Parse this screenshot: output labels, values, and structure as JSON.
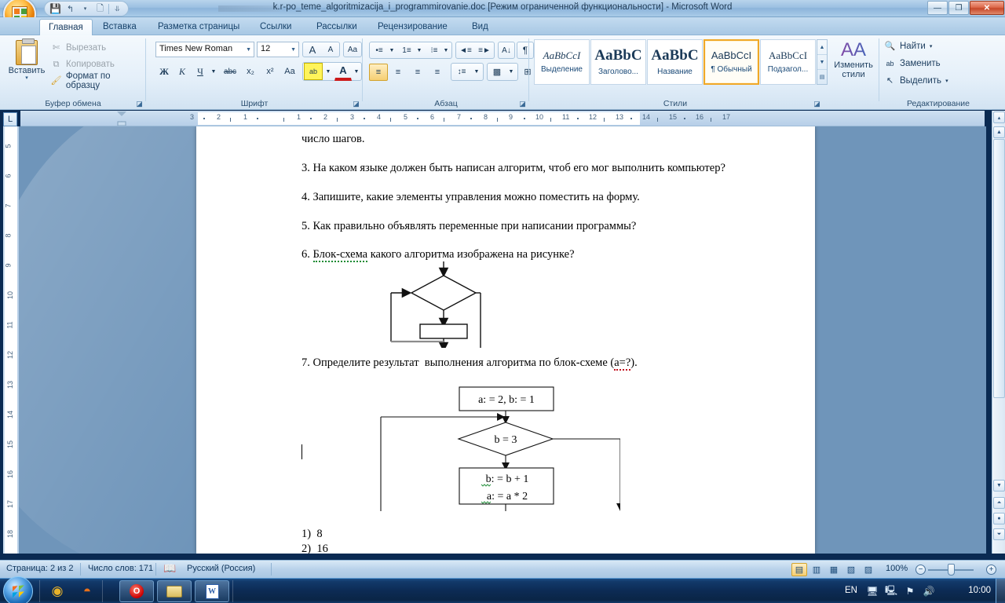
{
  "window": {
    "title": "k.r-po_teme_algoritmizacija_i_programmirovanie.doc [Режим ограниченной функциональности] - Microsoft Word",
    "minimize_label": "—",
    "restore_label": "❐",
    "close_label": "✕"
  },
  "quick_access": {
    "save_label": "💾",
    "undo_label": "↰",
    "undo_arrow": "▾",
    "new_label": "🗋",
    "customize_label": "⥥"
  },
  "ribbon": {
    "tabs": [
      {
        "label": "Главная",
        "active": true
      },
      {
        "label": "Вставка",
        "active": false
      },
      {
        "label": "Разметка страницы",
        "active": false
      },
      {
        "label": "Ссылки",
        "active": false
      },
      {
        "label": "Рассылки",
        "active": false
      },
      {
        "label": "Рецензирование",
        "active": false
      },
      {
        "label": "Вид",
        "active": false
      }
    ],
    "clipboard": {
      "group_label": "Буфер обмена",
      "paste_label": "Вставить",
      "paste_arrow": "▾",
      "cut_label": "Вырезать",
      "copy_label": "Копировать",
      "format_painter_label": "Формат по образцу",
      "launcher": "◪"
    },
    "font": {
      "group_label": "Шрифт",
      "font_name": "Times New Roman",
      "font_size": "12",
      "grow_label": "A",
      "shrink_label": "A",
      "clear_format_label": "Aa",
      "bold_label": "Ж",
      "italic_label": "К",
      "underline_label": "Ч",
      "strike_label": "abc",
      "subscript_label": "x₂",
      "superscript_label": "x²",
      "change_case_label": "Aa",
      "highlight_label": "ab",
      "font_color_label": "A",
      "launcher": "◪"
    },
    "paragraph": {
      "group_label": "Абзац",
      "bullets_label": "•≡",
      "numbering_label": "1≡",
      "multilevel_label": "⁝≡",
      "decrease_indent_label": "◄≡",
      "increase_indent_label": "≡►",
      "sort_label": "A↓",
      "marks_label": "¶",
      "align_left_label": "≡",
      "align_center_label": "≡",
      "align_right_label": "≡",
      "justify_label": "≡",
      "line_spacing_label": "↕≡",
      "shading_label": "▩",
      "borders_label": "⊞",
      "launcher": "◪"
    },
    "styles": {
      "group_label": "Стили",
      "items": [
        {
          "sample": "AaBbCcI",
          "name": "Выделение",
          "selected": false,
          "style": "italic-serif"
        },
        {
          "sample": "AaBbC",
          "name": "Заголово...",
          "selected": false,
          "style": "bold-serif-lg"
        },
        {
          "sample": "AaBbC",
          "name": "Название",
          "selected": false,
          "style": "bold-serif-lg"
        },
        {
          "sample": "AaBbCcI",
          "name": "¶ Обычный",
          "selected": true,
          "style": "plain-sans"
        },
        {
          "sample": "AaBbCcI",
          "name": "Подзагол...",
          "selected": false,
          "style": "plain-serif"
        }
      ],
      "scroll_up": "▲",
      "scroll_down": "▼",
      "scroll_more": "▤",
      "change_styles_label": "Изменить",
      "change_styles_label2": "стили",
      "change_styles_arrow": "▾",
      "change_styles_glyph": "AA",
      "launcher": "◪"
    },
    "editing": {
      "group_label": "Редактирование",
      "find_label": "Найти",
      "find_arrow": "▾",
      "replace_label": "Заменить",
      "select_label": "Выделить",
      "select_arrow": "▾"
    }
  },
  "ruler": {
    "corner_tab_label": "L",
    "horizontal_labels": [
      "3",
      "2",
      "1",
      "1",
      "2",
      "3",
      "4",
      "5",
      "6",
      "7",
      "8",
      "9",
      "10",
      "11",
      "12",
      "13",
      "14",
      "15",
      "16",
      "17"
    ],
    "vertical_labels": [
      "5",
      "6",
      "7",
      "8",
      "9",
      "10",
      "11",
      "12",
      "13",
      "14",
      "15",
      "16",
      "17",
      "18"
    ]
  },
  "document": {
    "paragraphs": [
      {
        "text": "число шагов."
      },
      {
        "text": "3.  На каком языке должен быть написан алгоритм, чтоб его мог выполнить компьютер?"
      },
      {
        "text": "4. Запишите, какие элементы управления можно поместить на форму."
      },
      {
        "text": "5. Как правильно объявлять переменные при написании программы?"
      },
      {
        "text": "6. Блок-схема какого алгоритма изображена на рисунке?",
        "misspelled": "Блок-схема"
      },
      {
        "text": "7. Определите результат  выполнения алгоритма по блок-схеме (а=?).",
        "misspelled": "а=?"
      }
    ],
    "flowchart_1": {
      "decision_text": "",
      "process_text": ""
    },
    "flowchart_2": {
      "init_text": "a: = 2, b: = 1",
      "decision_text": "b = 3",
      "process_line1": "b: = b + 1",
      "process_line2": "a: = a * 2"
    },
    "answers": [
      {
        "num": "1)",
        "value": "8"
      },
      {
        "num": "2)",
        "value": "16"
      }
    ]
  },
  "statusbar": {
    "page_label": "Страница: 2 из 2",
    "words_label": "Число слов: 171",
    "proofing_icon": "book-check-icon",
    "language_label": "Русский (Россия)",
    "views": [
      {
        "name": "print-layout",
        "glyph": "▤",
        "active": true
      },
      {
        "name": "full-screen-reading",
        "glyph": "▥",
        "active": false
      },
      {
        "name": "web-layout",
        "glyph": "▦",
        "active": false
      },
      {
        "name": "outline",
        "glyph": "▧",
        "active": false
      },
      {
        "name": "draft",
        "glyph": "▨",
        "active": false
      }
    ],
    "zoom_label": "100%",
    "zoom_out_label": "−",
    "zoom_in_label": "+"
  },
  "taskbar": {
    "start_label": "start-orb",
    "pinned": [
      {
        "name": "chrome-icon",
        "glyph": "◉"
      },
      {
        "name": "firefox-icon",
        "glyph": "◓"
      }
    ],
    "windows": [
      {
        "name": "opera-taskbar-button",
        "glyph": "O"
      },
      {
        "name": "explorer-taskbar-button",
        "glyph": "🗀"
      },
      {
        "name": "word-taskbar-button",
        "glyph": "W"
      }
    ],
    "tray": [
      {
        "name": "network-monitor-icon",
        "glyph": "🖥"
      },
      {
        "name": "display-icon",
        "glyph": "🖳"
      },
      {
        "name": "network-disconnected-icon",
        "glyph": "⚑"
      },
      {
        "name": "volume-icon",
        "glyph": "🔊"
      }
    ],
    "language_label": "EN",
    "clock_label": "10:00"
  },
  "colors": {
    "accent": "#f0a827",
    "title_text": "#1f3a54",
    "ribbon_bg": "#e4eff9",
    "page_bg": "#ffffff",
    "desktop_bg": "#6f95ba",
    "taskbar_bg": "#0c2b54"
  }
}
